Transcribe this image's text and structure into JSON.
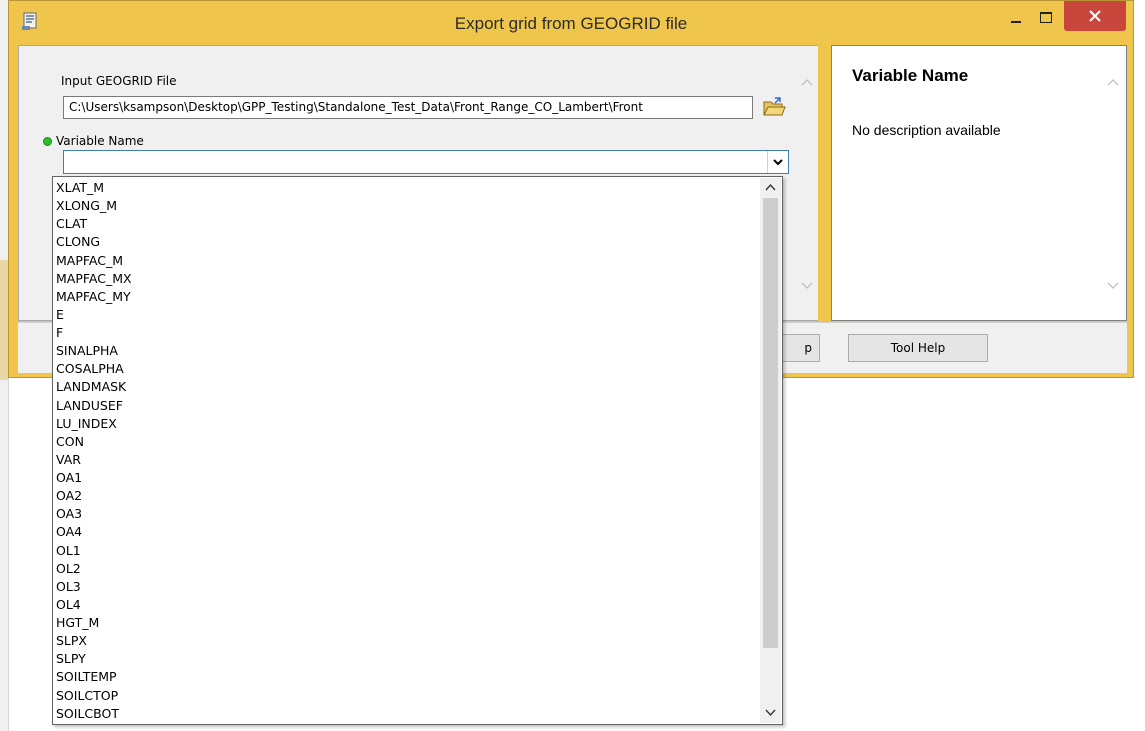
{
  "window": {
    "title": "Export grid from GEOGRID file",
    "close_color": "#c9463d",
    "frame_color": "#efc64b"
  },
  "form": {
    "input_label": "Input GEOGRID File",
    "input_value": "C:\\Users\\ksampson\\Desktop\\GPP_Testing\\Standalone_Test_Data\\Front_Range_CO_Lambert\\Front",
    "variable_label": "Variable Name",
    "variable_value": ""
  },
  "help": {
    "heading": "Variable Name",
    "text": "No description available"
  },
  "buttons": {
    "partial_label": "p",
    "tool_help": "Tool Help"
  },
  "dropdown": {
    "options": [
      "XLAT_M",
      "XLONG_M",
      "CLAT",
      "CLONG",
      "MAPFAC_M",
      "MAPFAC_MX",
      "MAPFAC_MY",
      "E",
      "F",
      "SINALPHA",
      "COSALPHA",
      "LANDMASK",
      "LANDUSEF",
      "LU_INDEX",
      "CON",
      "VAR",
      "OA1",
      "OA2",
      "OA3",
      "OA4",
      "OL1",
      "OL2",
      "OL3",
      "OL4",
      "HGT_M",
      "SLPX",
      "SLPY",
      "SOILTEMP",
      "SOILCTOP",
      "SOILCBOT"
    ]
  },
  "icons": {
    "app": "script-tool-icon",
    "browse": "open-folder-icon",
    "required": "green-dot-icon"
  }
}
